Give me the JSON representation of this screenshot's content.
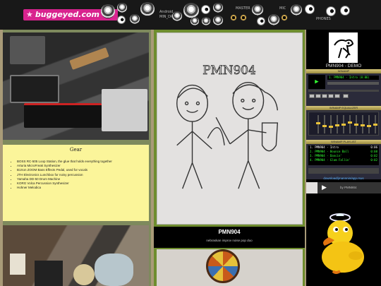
{
  "banner": {
    "logo_text": "buggeyed.com",
    "logo_color": "#d8238e",
    "labels": [
      "Android",
      "MIN_DRIVE",
      "MASTER",
      "MIC",
      "PHONES"
    ]
  },
  "gear": {
    "title": "Gear",
    "items": [
      "BOSS RC-505 Loop Station, the glue that holds everything together",
      "Arturia MicroFreak Synthesizer",
      "B1Xon ZOOM Bass Effects Pedal, used for vocals",
      "JTH Electronics Lunchbox for noisy percussion",
      "Yamaha DD-50 Drum Machine",
      "KORG Volca Percussion Synthesizer",
      "Hohner Melodica"
    ]
  },
  "drawing": {
    "caption": "PMN904"
  },
  "band": {
    "name": "PMN904",
    "tagline": "nebraskan improv noise pop duo"
  },
  "demo": {
    "label": "PMN904 - DEMO"
  },
  "winamp": {
    "title": "WINAMP",
    "time_display": "▶",
    "ticker": "1. PMN904 - Intro (0:06)",
    "eq_title": "WINAMP EQUALIZER",
    "eq_levels": [
      0.55,
      0.4,
      0.35,
      0.45,
      0.5,
      0.6,
      0.5,
      0.45,
      0.4,
      0.5
    ],
    "playlist_title": "WINAMP PLAYLIST",
    "playlist": [
      {
        "title": "1. PMN904 - Intro",
        "time": "0:06"
      },
      {
        "title": "2. PMN904 - Bounce Ball",
        "time": "0:08"
      },
      {
        "title": "3. PMN904 - Dancin'",
        "time": "0:02"
      },
      {
        "title": "4. PMN904 - Glam Fallin'",
        "time": "0:02"
      }
    ],
    "colors": {
      "display": "#33ff33",
      "frame": "#2b2b3a"
    }
  },
  "link": {
    "text": "download/jmannnin/app.rsus"
  },
  "player": {
    "play_icon": "▶",
    "by": "by PMN904"
  }
}
